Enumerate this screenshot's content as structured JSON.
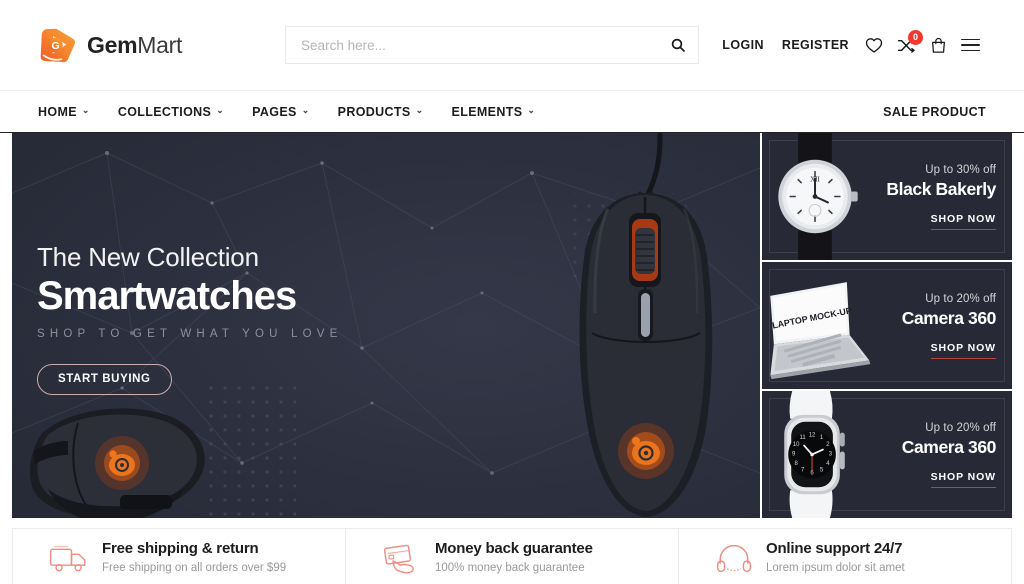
{
  "brand": {
    "name_bold": "Gem",
    "name_light": "Mart",
    "logo_icon": "gem-play-logo",
    "accent": "#f26f2c"
  },
  "search": {
    "placeholder": "Search here...",
    "value": "",
    "icon": "search-icon"
  },
  "header": {
    "login": "LOGIN",
    "register": "REGISTER",
    "wishlist_icon": "heart-icon",
    "compare_icon": "compare-shuffle-icon",
    "compare_count": "0",
    "cart_icon": "shopping-bag-icon",
    "menu_icon": "hamburger-menu-icon"
  },
  "nav": {
    "items": [
      {
        "label": "HOME",
        "caret": "⌄"
      },
      {
        "label": "COLLECTIONS",
        "caret": "⌄"
      },
      {
        "label": "PAGES",
        "caret": "⌄"
      },
      {
        "label": "PRODUCTS",
        "caret": "⌄"
      },
      {
        "label": "ELEMENTS",
        "caret": "⌄"
      }
    ],
    "sale": "SALE PRODUCT"
  },
  "hero": {
    "kicker": "The New Collection",
    "title": "Smartwatches",
    "subtitle": "SHOP TO GET WHAT YOU LOVE",
    "cta": "START BUYING",
    "bg_color": "#2b2e3b",
    "product_image": "gaming-mouse-pair"
  },
  "promos": [
    {
      "off": "Up to 30% off",
      "name": "Black Bakerly",
      "shop": "SHOP NOW",
      "image": "analog-wristwatch"
    },
    {
      "off": "Up to 20% off",
      "name": "Camera 360",
      "shop": "SHOP NOW",
      "image": "laptop-mockup"
    },
    {
      "off": "Up to 20% off",
      "name": "Camera 360",
      "shop": "SHOP NOW",
      "image": "smartwatch-white-band"
    }
  ],
  "features": [
    {
      "icon": "delivery-truck-icon",
      "title": "Free shipping & return",
      "desc": "Free shipping on all orders over $99"
    },
    {
      "icon": "money-back-card-icon",
      "title": "Money back guarantee",
      "desc": "100% money back guarantee"
    },
    {
      "icon": "headset-support-icon",
      "title": "Online support 24/7",
      "desc": "Lorem ipsum dolor sit amet"
    }
  ]
}
